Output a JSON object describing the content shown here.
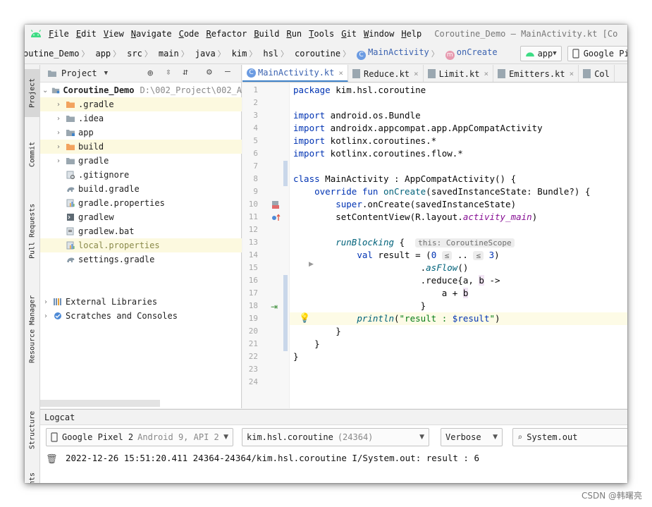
{
  "menu": [
    "File",
    "Edit",
    "View",
    "Navigate",
    "Code",
    "Refactor",
    "Build",
    "Run",
    "Tools",
    "Git",
    "Window",
    "Help"
  ],
  "window_title": "Coroutine_Demo – MainActivity.kt [Co",
  "breadcrumbs": [
    "outine_Demo",
    "app",
    "src",
    "main",
    "java",
    "kim",
    "hsl",
    "coroutine"
  ],
  "breadcrumb_class": "MainActivity",
  "breadcrumb_method": "onCreate",
  "run_config": "app",
  "device": "Google Pixel 2",
  "left_tabs": [
    "Project",
    "Commit",
    "Pull Requests",
    "Resource Manager",
    "Structure",
    "nts"
  ],
  "project_panel": {
    "title": "Project",
    "root_name": "Coroutine_Demo",
    "root_path": "D:\\002_Project\\002_A",
    "items": [
      {
        "label": ".gradle",
        "type": "folder-orange",
        "arrow": true,
        "highlight": true
      },
      {
        "label": ".idea",
        "type": "folder",
        "arrow": true,
        "highlight": false
      },
      {
        "label": "app",
        "type": "folder-module",
        "arrow": true,
        "highlight": false
      },
      {
        "label": "build",
        "type": "folder-orange",
        "arrow": true,
        "highlight": true
      },
      {
        "label": "gradle",
        "type": "folder",
        "arrow": true,
        "highlight": false
      },
      {
        "label": ".gitignore",
        "type": "file-ignore",
        "arrow": false,
        "highlight": false
      },
      {
        "label": "build.gradle",
        "type": "file-gradle",
        "arrow": false,
        "highlight": false
      },
      {
        "label": "gradle.properties",
        "type": "file-props",
        "arrow": false,
        "highlight": false
      },
      {
        "label": "gradlew",
        "type": "file-script",
        "arrow": false,
        "highlight": false
      },
      {
        "label": "gradlew.bat",
        "type": "file-bat",
        "arrow": false,
        "highlight": false
      },
      {
        "label": "local.properties",
        "type": "file-props",
        "arrow": false,
        "highlight": true
      },
      {
        "label": "settings.gradle",
        "type": "file-gradle",
        "arrow": false,
        "highlight": false
      }
    ],
    "external_libraries": "External Libraries",
    "scratches": "Scratches and Consoles"
  },
  "tabs": [
    {
      "label": "MainActivity.kt",
      "active": true
    },
    {
      "label": "Reduce.kt",
      "active": false
    },
    {
      "label": "Limit.kt",
      "active": false
    },
    {
      "label": "Emitters.kt",
      "active": false
    },
    {
      "label": "Col",
      "active": false
    }
  ],
  "code": {
    "line_numbers": [
      "1",
      "2",
      "3",
      "4",
      "5",
      "6",
      "7",
      "8",
      "9",
      "10",
      "11",
      "12",
      "13",
      "14",
      "15",
      "16",
      "17",
      "18",
      "19",
      "20",
      "21",
      "22",
      "23",
      "24"
    ],
    "l1_kw": "package",
    "l1_rest": " kim.hsl.coroutine",
    "l3_kw": "import",
    "l3_rest": " android.os.Bundle",
    "l4_kw": "import",
    "l4_rest": " androidx.appcompat.app.AppCompatActivity",
    "l5_kw": "import",
    "l5_rest": " kotlinx.coroutines.*",
    "l6_kw": "import",
    "l6_rest": " kotlinx.coroutines.flow.*",
    "l8_kw": "class",
    "l8_rest": " MainActivity : AppCompatActivity() {",
    "l9_kw": "override fun",
    "l9_fn": "onCreate",
    "l9_rest": "(savedInstanceState: Bundle?) {",
    "l10_kw": "super",
    "l10_rest": ".onCreate(savedInstanceState)",
    "l11_a": "setContentView(R.layout.",
    "l11_field": "activity_main",
    "l11_b": ")",
    "l13_fn": "runBlocking",
    "l13_brace": " {",
    "l13_hint": "this: CoroutineScope",
    "l14_kw": "val",
    "l14_a": " result = (",
    "l14_n0": "0",
    "l14_h1": "≤",
    "l14_dots": " ..",
    "l14_h2": "≤",
    "l14_n3": "3",
    "l14_b": ")",
    "l15_dot": ".",
    "l15_fn": "asFlow",
    "l15_rest": "()",
    "l16_a": ".reduce{",
    "l16_b": "a, ",
    "l16_c": "b",
    "l16_d": " ->",
    "l17_a": "a + ",
    "l17_b": "b",
    "l18": "}",
    "l19_fn": "println",
    "l19_a": "(",
    "l19_str1": "\"result : ",
    "l19_var": "$result",
    "l19_str2": "\"",
    "l19_b": ")",
    "l20": "}",
    "l21": "}",
    "l22": "}"
  },
  "logcat": {
    "title": "Logcat",
    "device": "Google Pixel 2",
    "device_detail": "Android 9, API 2",
    "process": "kim.hsl.coroutine",
    "pid": "(24364)",
    "level": "Verbose",
    "filter": "System.out",
    "log_line": "2022-12-26 15:51:20.411 24364-24364/kim.hsl.coroutine I/System.out: result : 6"
  },
  "watermark": "CSDN @韩曙亮",
  "colors": {
    "keyword": "#0033b3",
    "function": "#00627a",
    "string": "#067d17",
    "field": "#871094",
    "accent": "#4083c9"
  }
}
